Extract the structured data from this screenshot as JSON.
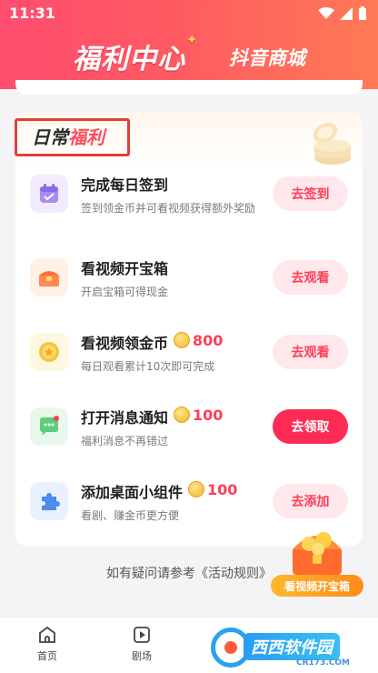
{
  "status_bar": {
    "time": "11:31"
  },
  "header": {
    "tab_welfare": "福利中心",
    "tab_mall": "抖音商城"
  },
  "section": {
    "title_part1": "日常",
    "title_part2": "福利"
  },
  "tasks": [
    {
      "title": "完成每日签到",
      "coin_amount": "",
      "desc": "签到领金币并可看视频获得额外奖励",
      "button": "去签到",
      "icon": "calendar-icon",
      "icon_bg": "#f1ecff"
    },
    {
      "title": "看视频开宝箱",
      "coin_amount": "",
      "desc": "开启宝箱可得现金",
      "button": "去观看",
      "icon": "treasure-chest-icon",
      "icon_bg": "#fff1e6"
    },
    {
      "title": "看视频领金币",
      "coin_amount": "800",
      "desc": "每日观看累计10次即可完成",
      "button": "去观看",
      "icon": "gold-coin-icon",
      "icon_bg": "#fff8e0"
    },
    {
      "title": "打开消息通知",
      "coin_amount": "100",
      "desc": "福利消息不再错过",
      "button": "去领取",
      "icon": "message-bubble-icon",
      "icon_bg": "#e8f8ec"
    },
    {
      "title": "添加桌面小组件",
      "coin_amount": "100",
      "desc": "看剧、赚金币更方便",
      "button": "去添加",
      "icon": "puzzle-piece-icon",
      "icon_bg": "#e9f1ff"
    }
  ],
  "footer": {
    "text": "如有疑问请参考《活动规则》"
  },
  "floating_chest": {
    "label": "看视频开宝箱"
  },
  "bottom_nav": [
    {
      "label": "首页",
      "icon": "home-icon"
    },
    {
      "label": "剧场",
      "icon": "theater-icon"
    }
  ],
  "watermark": {
    "text": "西西软件园",
    "sub": "CR173.COM"
  },
  "colors": {
    "accent": "#fe2c55",
    "header_start": "#ff4d6f",
    "header_end": "#ff7a55",
    "coin_text": "#ff3d57"
  }
}
